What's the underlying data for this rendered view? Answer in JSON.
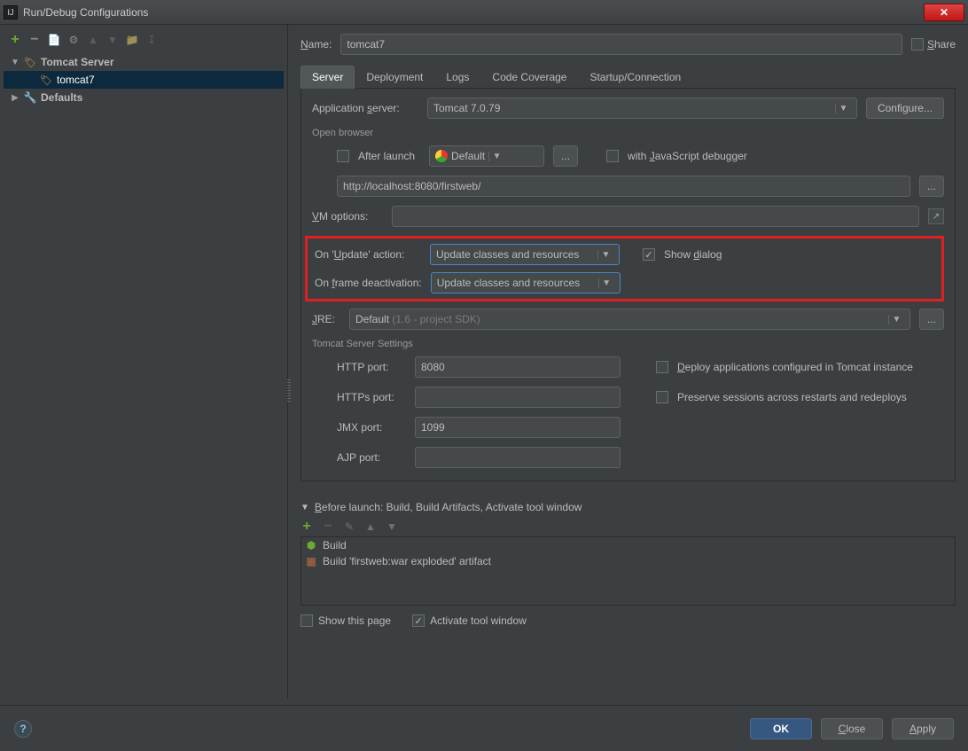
{
  "window": {
    "title": "Run/Debug Configurations"
  },
  "tree": {
    "group1": "Tomcat Server",
    "item1": "tomcat7",
    "group2": "Defaults"
  },
  "name": {
    "label": "Name:",
    "value": "tomcat7",
    "share": "Share"
  },
  "tabs": {
    "server": "Server",
    "deployment": "Deployment",
    "logs": "Logs",
    "coverage": "Code Coverage",
    "startup": "Startup/Connection"
  },
  "server": {
    "app_server_label": "Application server:",
    "app_server_value": "Tomcat 7.0.79",
    "configure": "Configure...",
    "open_browser": "Open browser",
    "after_launch": "After launch",
    "browser_default": "Default",
    "with_js": "with JavaScript debugger",
    "url": "http://localhost:8080/firstweb/",
    "vm_label": "VM options:",
    "on_update_label": "On 'Update' action:",
    "on_update_value": "Update classes and resources",
    "show_dialog": "Show dialog",
    "on_frame_label": "On frame deactivation:",
    "on_frame_value": "Update classes and resources",
    "jre_label": "JRE:",
    "jre_value_prefix": "Default",
    "jre_value_suffix": "(1.6 - project SDK)",
    "settings_title": "Tomcat Server Settings",
    "http_port_label": "HTTP port:",
    "http_port": "8080",
    "https_port_label": "HTTPs port:",
    "https_port": "",
    "jmx_port_label": "JMX port:",
    "jmx_port": "1099",
    "ajp_port_label": "AJP port:",
    "ajp_port": "",
    "deploy_configured": "Deploy applications configured in Tomcat instance",
    "preserve_sessions": "Preserve sessions across restarts and redeploys"
  },
  "before": {
    "title": "Before launch: Build, Build Artifacts, Activate tool window",
    "item1": "Build",
    "item2": "Build 'firstweb:war exploded' artifact",
    "show_page": "Show this page",
    "activate": "Activate tool window"
  },
  "buttons": {
    "ok": "OK",
    "cancel": "Close",
    "apply": "Apply"
  }
}
